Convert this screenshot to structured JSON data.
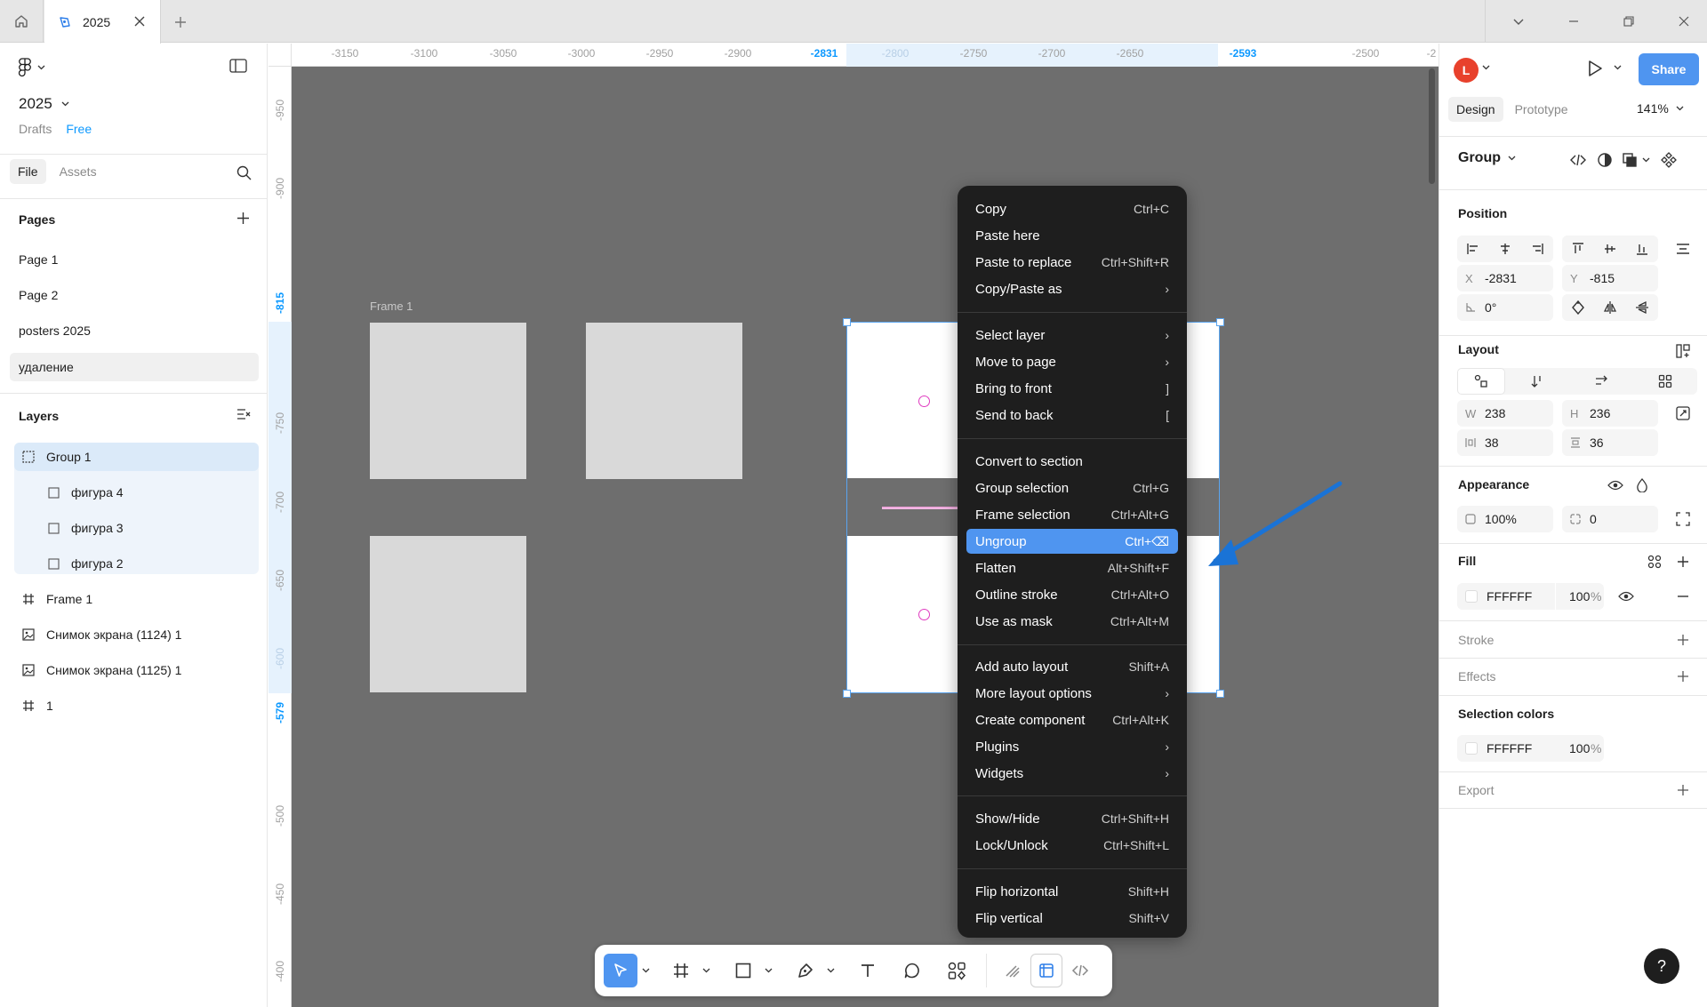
{
  "titlebar": {
    "tab_title": "2025"
  },
  "left": {
    "file_name": "2025",
    "location": "Drafts",
    "plan": "Free",
    "tab_file": "File",
    "tab_assets": "Assets",
    "pages_title": "Pages",
    "pages": [
      "Page 1",
      "Page 2",
      "posters 2025",
      "удаление"
    ],
    "layers_title": "Layers",
    "layers": [
      {
        "name": "Group 1",
        "icon": "group-icon"
      },
      {
        "name": "фигура 4",
        "icon": "rectangle-icon"
      },
      {
        "name": "фигура 3",
        "icon": "rectangle-icon"
      },
      {
        "name": "фигура 2",
        "icon": "rectangle-icon"
      },
      {
        "name": "Frame 1",
        "icon": "frame-icon"
      },
      {
        "name": "Снимок экрана (1124) 1",
        "icon": "image-icon"
      },
      {
        "name": "Снимок экрана (1125) 1",
        "icon": "image-icon"
      },
      {
        "name": "1",
        "icon": "frame-icon"
      }
    ]
  },
  "canvas": {
    "frame_label": "Frame 1",
    "ruler_top": [
      "-3150",
      "-3100",
      "-3050",
      "-3000",
      "-2950",
      "-2900",
      "-2831",
      "-2800",
      "-2750",
      "-2700",
      "-2650",
      "-2593",
      "-2500",
      "-2"
    ],
    "ruler_left": [
      "-950",
      "-900",
      "-815",
      "-750",
      "-700",
      "-650",
      "-600",
      "-579",
      "-500",
      "-450",
      "-400"
    ],
    "context_menu": [
      {
        "label": "Copy",
        "shortcut": "Ctrl+C"
      },
      {
        "label": "Paste here",
        "shortcut": ""
      },
      {
        "label": "Paste to replace",
        "shortcut": "Ctrl+Shift+R"
      },
      {
        "label": "Copy/Paste as",
        "shortcut": "›"
      },
      {
        "label": "Select layer",
        "shortcut": "›"
      },
      {
        "label": "Move to page",
        "shortcut": "›"
      },
      {
        "label": "Bring to front",
        "shortcut": "]"
      },
      {
        "label": "Send to back",
        "shortcut": "["
      },
      {
        "label": "Convert to section",
        "shortcut": ""
      },
      {
        "label": "Group selection",
        "shortcut": "Ctrl+G"
      },
      {
        "label": "Frame selection",
        "shortcut": "Ctrl+Alt+G"
      },
      {
        "label": "Ungroup",
        "shortcut": "Ctrl+⌫"
      },
      {
        "label": "Flatten",
        "shortcut": "Alt+Shift+F"
      },
      {
        "label": "Outline stroke",
        "shortcut": "Ctrl+Alt+O"
      },
      {
        "label": "Use as mask",
        "shortcut": "Ctrl+Alt+M"
      },
      {
        "label": "Add auto layout",
        "shortcut": "Shift+A"
      },
      {
        "label": "More layout options",
        "shortcut": "›"
      },
      {
        "label": "Create component",
        "shortcut": "Ctrl+Alt+K"
      },
      {
        "label": "Plugins",
        "shortcut": "›"
      },
      {
        "label": "Widgets",
        "shortcut": "›"
      },
      {
        "label": "Show/Hide",
        "shortcut": "Ctrl+Shift+H"
      },
      {
        "label": "Lock/Unlock",
        "shortcut": "Ctrl+Shift+L"
      },
      {
        "label": "Flip horizontal",
        "shortcut": "Shift+H"
      },
      {
        "label": "Flip vertical",
        "shortcut": "Shift+V"
      }
    ],
    "highlighted_item": "Ungroup"
  },
  "right": {
    "avatar_letter": "L",
    "share_label": "Share",
    "tab_design": "Design",
    "tab_prototype": "Prototype",
    "zoom": "141%",
    "selection_type": "Group",
    "position_title": "Position",
    "x_label": "X",
    "x_value": "-2831",
    "y_label": "Y",
    "y_value": "-815",
    "rotation": "0°",
    "layout_title": "Layout",
    "w_label": "W",
    "w_value": "238",
    "h_label": "H",
    "h_value": "236",
    "gap_h": "38",
    "gap_v": "36",
    "appearance_title": "Appearance",
    "opacity": "100%",
    "radius": "0",
    "fill_title": "Fill",
    "fill_hex": "FFFFFF",
    "fill_opacity": "100",
    "percent": "%",
    "stroke_title": "Stroke",
    "effects_title": "Effects",
    "selection_colors_title": "Selection colors",
    "sel_color_hex": "FFFFFF",
    "sel_color_opacity": "100",
    "export_title": "Export",
    "help": "?"
  },
  "colors": {
    "accent": "#4f95f0",
    "selection": "#5aa4ef",
    "canvas": "#6e6e6e",
    "menu_bg": "#1e1e1e",
    "avatar": "#e8412c",
    "pink": "#e03cc0"
  }
}
